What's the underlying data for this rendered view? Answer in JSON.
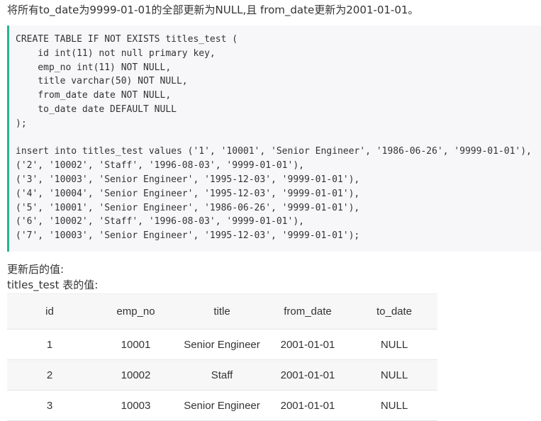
{
  "intro_text": "将所有to_date为9999-01-01的全部更新为NULL,且 from_date更新为2001-01-01。",
  "code_lines": [
    "CREATE TABLE IF NOT EXISTS titles_test (",
    "    id int(11) not null primary key,",
    "    emp_no int(11) NOT NULL,",
    "    title varchar(50) NOT NULL,",
    "    from_date date NOT NULL,",
    "    to_date date DEFAULT NULL",
    ");",
    "",
    "insert into titles_test values ('1', '10001', 'Senior Engineer', '1986-06-26', '9999-01-01'),",
    "('2', '10002', 'Staff', '1996-08-03', '9999-01-01'),",
    "('3', '10003', 'Senior Engineer', '1995-12-03', '9999-01-01'),",
    "('4', '10004', 'Senior Engineer', '1995-12-03', '9999-01-01'),",
    "('5', '10001', 'Senior Engineer', '1986-06-26', '9999-01-01'),",
    "('6', '10002', 'Staff', '1996-08-03', '9999-01-01'),",
    "('7', '10003', 'Senior Engineer', '1995-12-03', '9999-01-01');"
  ],
  "label_updated": "更新后的值:",
  "label_table": "titles_test 表的值:",
  "table": {
    "columns": [
      "id",
      "emp_no",
      "title",
      "from_date",
      "to_date"
    ],
    "rows": [
      [
        "1",
        "10001",
        "Senior Engineer",
        "2001-01-01",
        "NULL"
      ],
      [
        "2",
        "10002",
        "Staff",
        "2001-01-01",
        "NULL"
      ],
      [
        "3",
        "10003",
        "Senior Engineer",
        "2001-01-01",
        "NULL"
      ]
    ]
  },
  "colors": {
    "code_accent": "#26b38f",
    "code_background": "#f7f7f9",
    "table_header_background": "#f7f7f7"
  }
}
